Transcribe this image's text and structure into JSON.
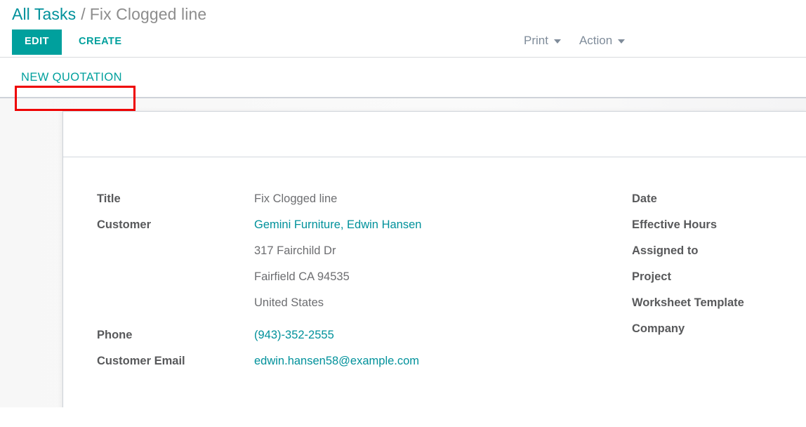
{
  "colors": {
    "accent_teal": "#00a09d",
    "link_teal": "#00919b",
    "highlight_red": "#ee0000",
    "label_gray": "#58595b",
    "value_gray": "#6d6e71",
    "muted_gray": "#8d8d8d",
    "menu_gray": "#7f8c9a"
  },
  "breadcrumb": {
    "root_label": "All Tasks",
    "separator": "/",
    "current_label": "Fix Clogged line"
  },
  "control_panel": {
    "edit_label": "EDIT",
    "create_label": "CREATE",
    "print_label": "Print",
    "action_label": "Action",
    "print_caret": "chevron-down-icon",
    "action_caret": "chevron-down-icon"
  },
  "stat_buttons": {
    "new_quotation_label": "NEW QUOTATION"
  },
  "form": {
    "left_column": [
      {
        "label": "Title",
        "value": "Fix Clogged line",
        "is_link": false,
        "extra_lines": []
      },
      {
        "label": "Customer",
        "value": "Gemini Furniture, Edwin Hansen",
        "is_link": true,
        "extra_lines": [
          "317 Fairchild Dr",
          "Fairfield CA 94535",
          "United States"
        ]
      },
      {
        "label": "Phone",
        "value": "(943)-352-2555",
        "is_link": true,
        "extra_lines": []
      },
      {
        "label": "Customer Email",
        "value": "edwin.hansen58@example.com",
        "is_link": true,
        "extra_lines": []
      }
    ],
    "right_column": [
      {
        "label": "Date",
        "value": ""
      },
      {
        "label": "Effective Hours",
        "value": ""
      },
      {
        "label": "Assigned to",
        "value": ""
      },
      {
        "label": "Project",
        "value": ""
      },
      {
        "label": "Worksheet Template",
        "value": ""
      },
      {
        "label": "Company",
        "value": ""
      }
    ]
  }
}
